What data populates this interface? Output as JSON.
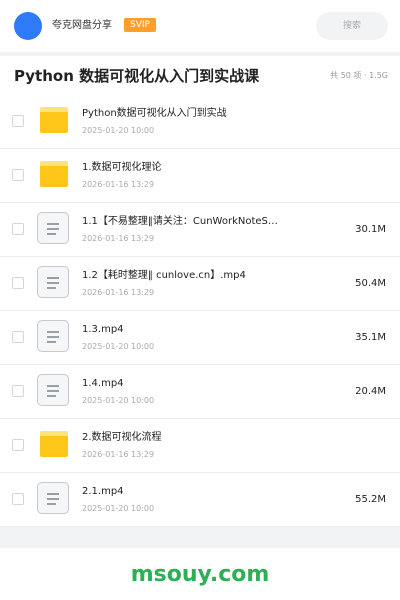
{
  "header": {
    "owner_name": "夸克网盘分享",
    "badge": "SVIP",
    "search_placeholder": "搜索"
  },
  "share": {
    "title": "Python 数据可视化从入门到实战课",
    "summary": "共 50 项 · 1.5G"
  },
  "files": [
    {
      "type": "folder",
      "name": "Python数据可视化从入门到实战",
      "date": "2025-01-20 10:00",
      "size": ""
    },
    {
      "type": "folder",
      "name": "1.数据可视化理论",
      "date": "2026-01-16 13:29",
      "size": ""
    },
    {
      "type": "file",
      "name": "1.1【不易整理‖请关注：CunWorkNoteS…",
      "date": "2026-01-16 13:29",
      "size": "30.1M"
    },
    {
      "type": "file",
      "name": "1.2【耗时整理‖ cunlove.cn】.mp4",
      "date": "2026-01-16 13:29",
      "size": "50.4M"
    },
    {
      "type": "file",
      "name": "1.3.mp4",
      "date": "2025-01-20 10:00",
      "size": "35.1M"
    },
    {
      "type": "file",
      "name": "1.4.mp4",
      "date": "2025-01-20 10:00",
      "size": "20.4M"
    },
    {
      "type": "folder",
      "name": "2.数据可视化流程",
      "date": "2026-01-16 13:29",
      "size": ""
    },
    {
      "type": "file",
      "name": "2.1.mp4",
      "date": "2025-01-20 10:00",
      "size": "55.2M"
    }
  ],
  "watermark": "msouy.com",
  "colors": {
    "accent": "#2f7af8",
    "badge": "#ff9f2a",
    "folder": "#ffc61a",
    "watermark": "#2fae55"
  }
}
